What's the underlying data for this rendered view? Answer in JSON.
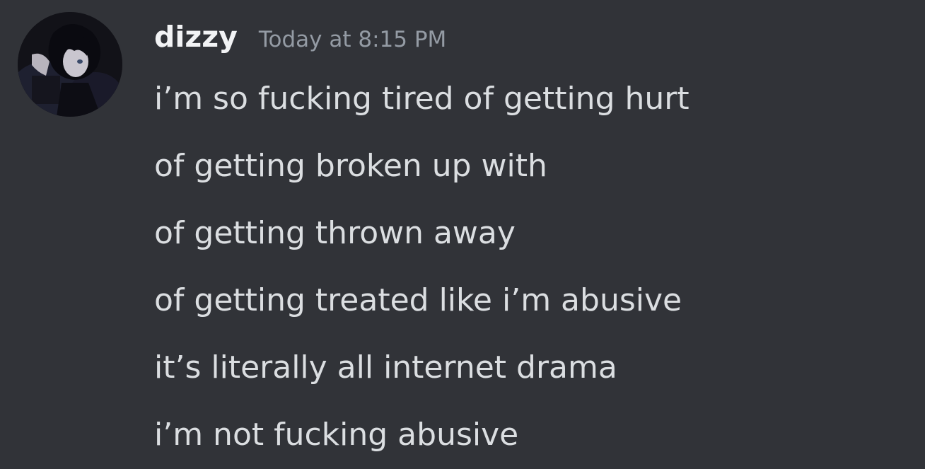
{
  "message": {
    "author": {
      "username": "dizzy",
      "avatar_icon": "profile-avatar-icon"
    },
    "timestamp": "Today at 8:15 PM",
    "lines": [
      "i’m so fucking tired of getting hurt",
      "of getting broken up with",
      "of getting thrown away",
      "of getting treated like i’m abusive",
      "it’s literally all internet drama",
      "i’m not fucking abusive"
    ]
  },
  "colors": {
    "background": "#313338",
    "username": "#f2f3f5",
    "timestamp": "#949ba4",
    "message_text": "#dbdee1"
  }
}
